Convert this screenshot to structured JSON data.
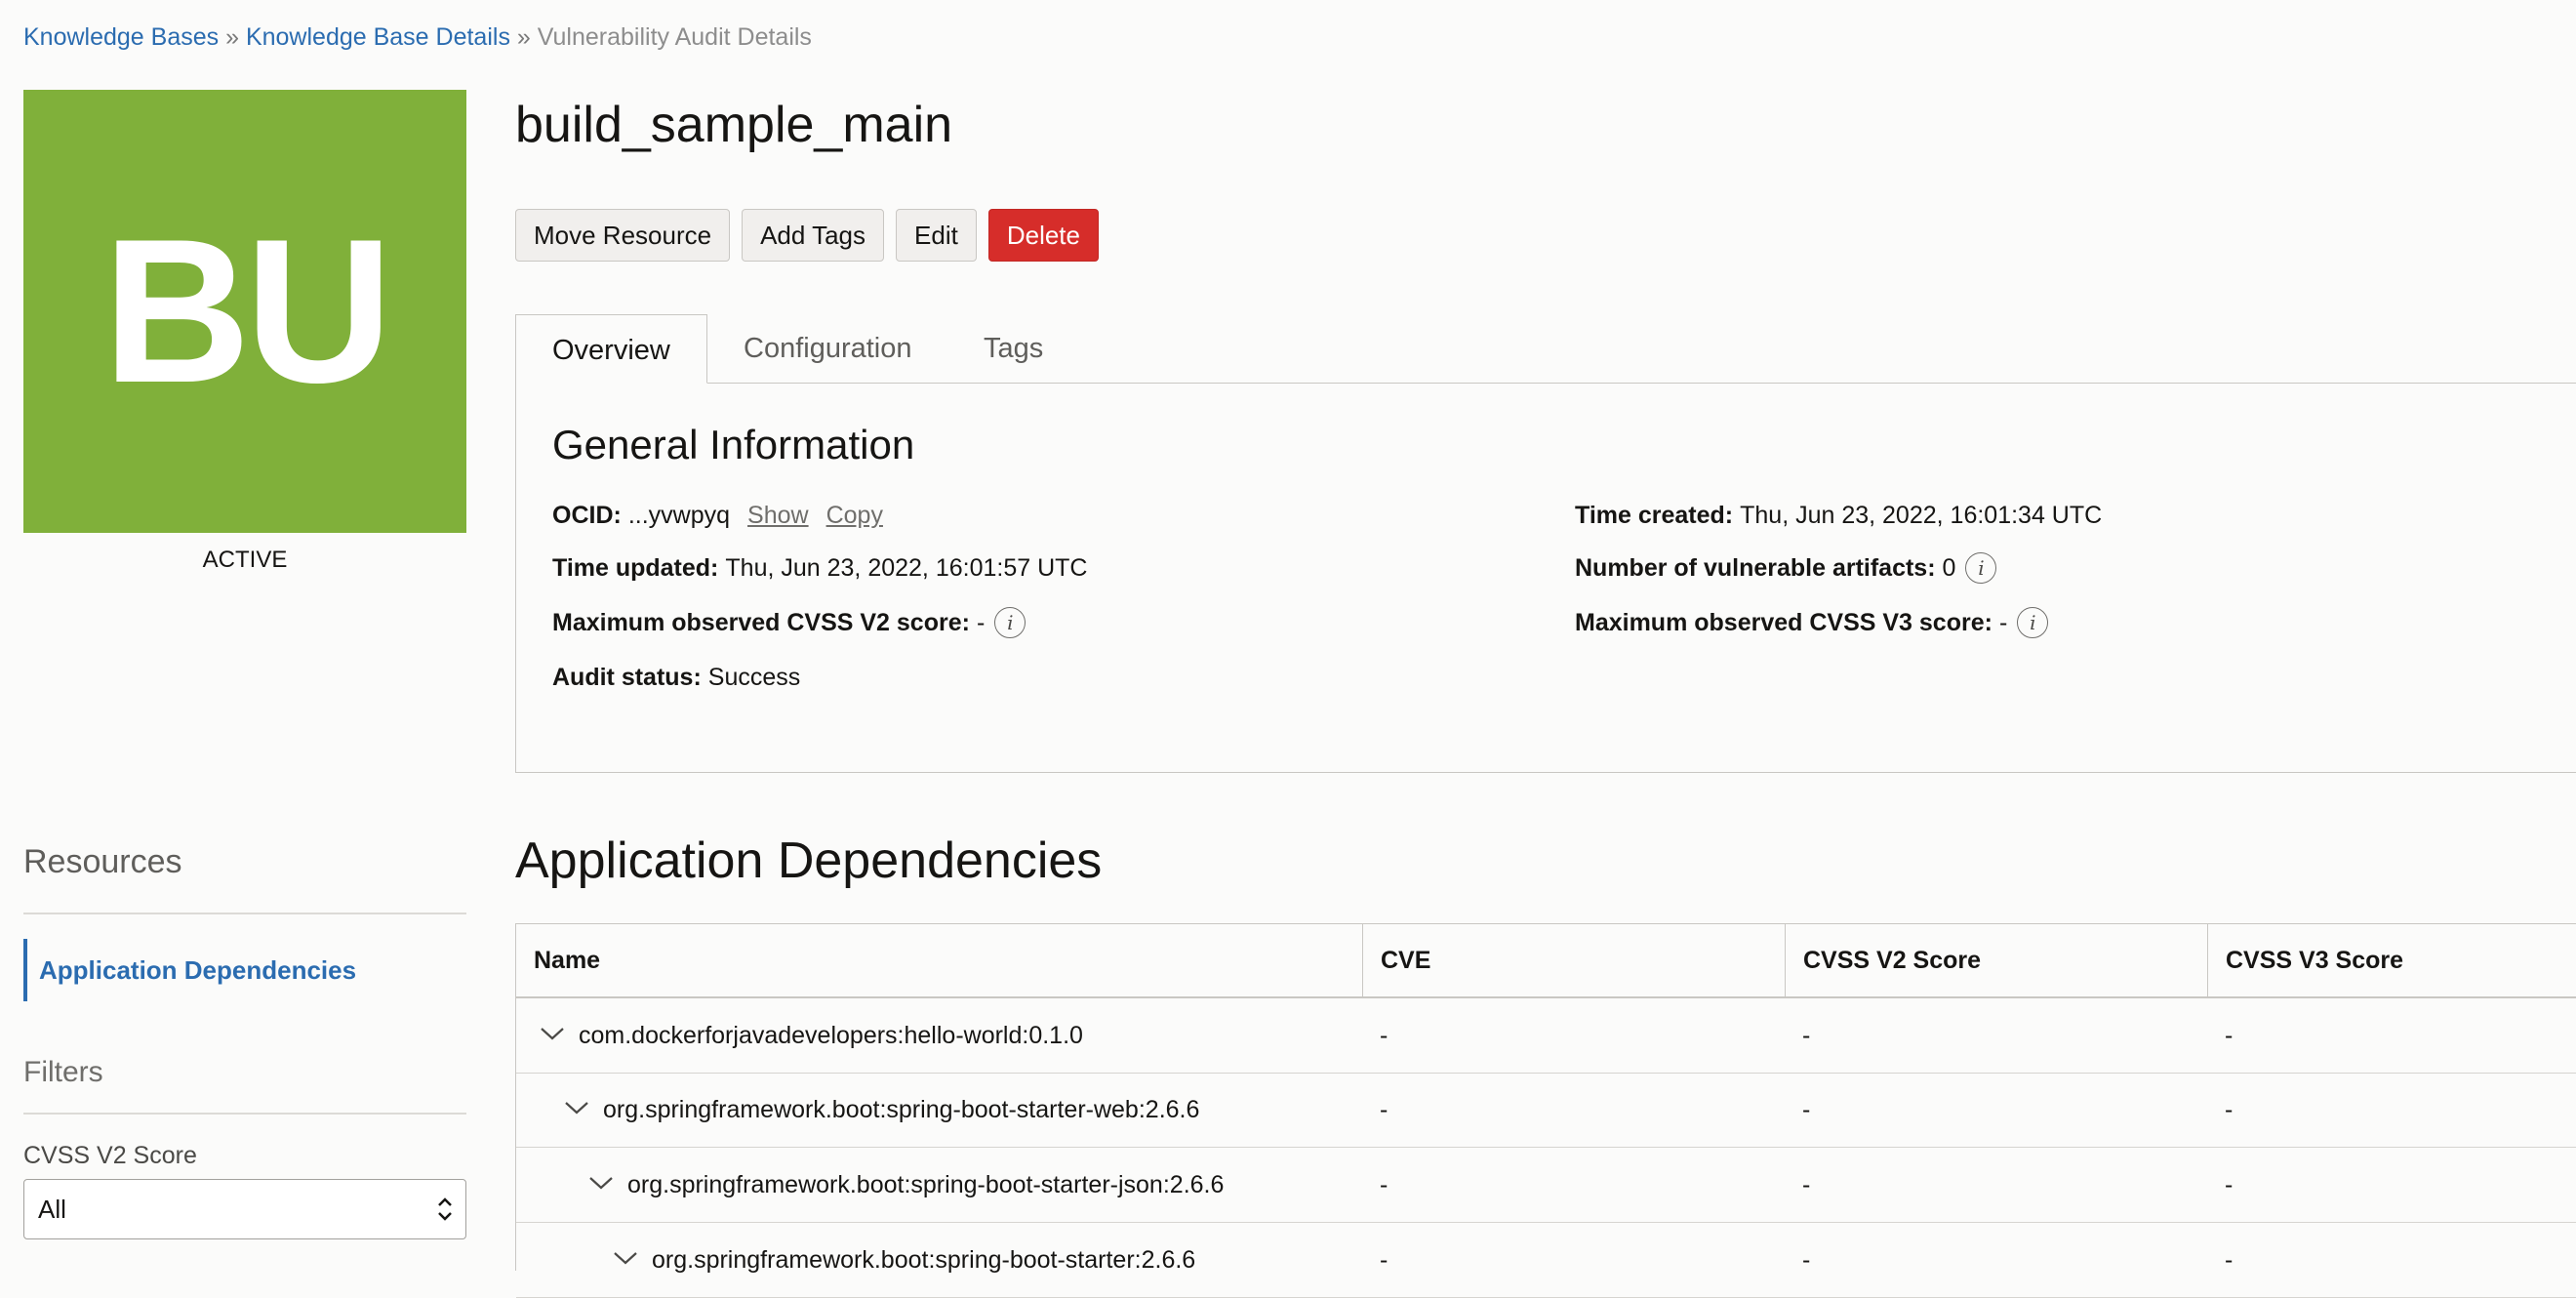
{
  "breadcrumb": {
    "items": [
      "Knowledge Bases",
      "Knowledge Base Details"
    ],
    "separator": "»",
    "current": "Vulnerability Audit Details"
  },
  "avatar": {
    "initials": "BU",
    "color": "#80b03a"
  },
  "status": "ACTIVE",
  "title": "build_sample_main",
  "actions": {
    "move_label": "Move Resource",
    "add_tags_label": "Add Tags",
    "edit_label": "Edit",
    "delete_label": "Delete"
  },
  "tabs": [
    {
      "label": "Overview",
      "active": true
    },
    {
      "label": "Configuration",
      "active": false
    },
    {
      "label": "Tags",
      "active": false
    }
  ],
  "general_info": {
    "heading": "General Information",
    "ocid_label": "OCID:",
    "ocid_value": "...yvwpyq",
    "show_label": "Show",
    "copy_label": "Copy",
    "time_created_label": "Time created:",
    "time_created_value": "Thu, Jun 23, 2022, 16:01:34 UTC",
    "time_updated_label": "Time updated:",
    "time_updated_value": "Thu, Jun 23, 2022, 16:01:57 UTC",
    "vuln_artifacts_label": "Number of vulnerable artifacts:",
    "vuln_artifacts_value": "0",
    "cvss_v2_label": "Maximum observed CVSS V2 score:",
    "cvss_v2_value": "-",
    "cvss_v3_label": "Maximum observed CVSS V3 score:",
    "cvss_v3_value": "-",
    "audit_status_label": "Audit status:",
    "audit_status_value": "Success"
  },
  "sidebar": {
    "resources_heading": "Resources",
    "resources": [
      {
        "label": "Application Dependencies",
        "active": true
      }
    ],
    "filters_heading": "Filters",
    "filter_cvss_v2_label": "CVSS V2 Score",
    "filter_cvss_v2_value": "All"
  },
  "dependencies": {
    "heading": "Application Dependencies",
    "columns": [
      "Name",
      "CVE",
      "CVSS V2 Score",
      "CVSS V3 Score"
    ],
    "rows": [
      {
        "name": "com.dockerforjavadevelopers:hello-world:0.1.0",
        "level": 0,
        "cve": "-",
        "cvss_v2": "-",
        "cvss_v3": "-"
      },
      {
        "name": "org.springframework.boot:spring-boot-starter-web:2.6.6",
        "level": 1,
        "cve": "-",
        "cvss_v2": "-",
        "cvss_v3": "-"
      },
      {
        "name": "org.springframework.boot:spring-boot-starter-json:2.6.6",
        "level": 2,
        "cve": "-",
        "cvss_v2": "-",
        "cvss_v3": "-"
      },
      {
        "name": "org.springframework.boot:spring-boot-starter:2.6.6",
        "level": 3,
        "cve": "-",
        "cvss_v2": "-",
        "cvss_v3": "-"
      }
    ]
  },
  "colors": {
    "link": "#2b6cb0",
    "danger": "#d62d2a"
  }
}
